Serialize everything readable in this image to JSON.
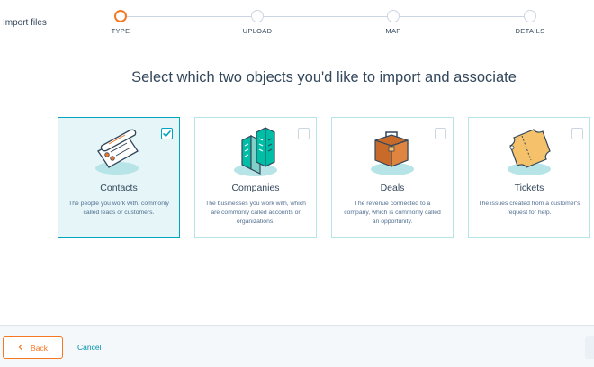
{
  "header": {
    "label": "Import files"
  },
  "stepper": {
    "steps": [
      {
        "label": "TYPE",
        "active": true
      },
      {
        "label": "UPLOAD",
        "active": false
      },
      {
        "label": "MAP",
        "active": false
      },
      {
        "label": "DETAILS",
        "active": false
      }
    ]
  },
  "main": {
    "title": "Select which two objects you'd like to import and associate"
  },
  "cards": [
    {
      "title": "Contacts",
      "description": "The people you work with, commonly called leads or customers.",
      "selected": true,
      "icon": "contacts-icon"
    },
    {
      "title": "Companies",
      "description": "The businesses you work with, which are commonly called accounts or organizations.",
      "selected": false,
      "icon": "companies-icon"
    },
    {
      "title": "Deals",
      "description": "The revenue connected to a company, which is commonly called an opportunity.",
      "selected": false,
      "icon": "deals-icon"
    },
    {
      "title": "Tickets",
      "description": "The issues created from a customer's request for help.",
      "selected": false,
      "icon": "tickets-icon"
    }
  ],
  "footer": {
    "back_label": "Back",
    "cancel_label": "Cancel"
  },
  "colors": {
    "accent": "#f57722",
    "teal": "#00a4bd",
    "selected_bg": "#e5f5f8",
    "link": "#0091ae"
  }
}
